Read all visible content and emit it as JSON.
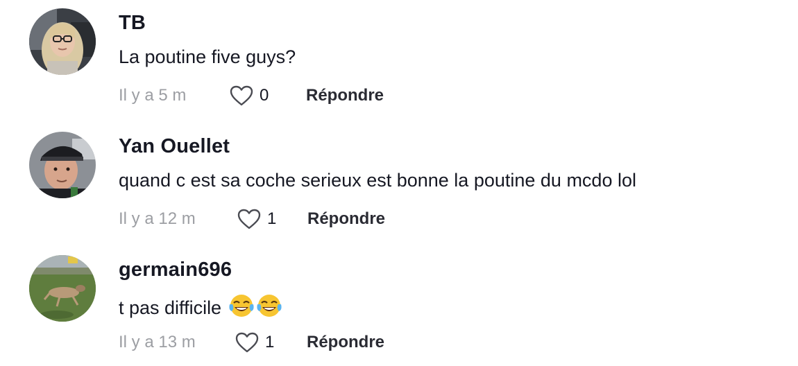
{
  "comments": [
    {
      "username": "TB",
      "text": "La poutine five guys?",
      "time": "Il y a 5 m",
      "likes": "0",
      "reply_label": "Répondre",
      "avatar_icon": "user-photo-woman-glasses"
    },
    {
      "username": "Yan Ouellet",
      "text": "quand c est sa coche serieux est bonne la poutine du mcdo lol",
      "time": "Il y a 12 m",
      "likes": "1",
      "reply_label": "Répondre",
      "avatar_icon": "user-photo-man-cap"
    },
    {
      "username": "germain696",
      "text": "t pas difficile",
      "emojis": [
        "face-with-tears-of-joy",
        "face-with-tears-of-joy"
      ],
      "time": "Il y a 13 m",
      "likes": "1",
      "reply_label": "Répondre",
      "avatar_icon": "user-photo-deer-on-grass"
    }
  ],
  "icons": {
    "like": "heart-outline-icon"
  },
  "colors": {
    "primary_text": "#161823",
    "secondary_text": "#9c9ea3",
    "icon_stroke": "#4a4b52"
  }
}
